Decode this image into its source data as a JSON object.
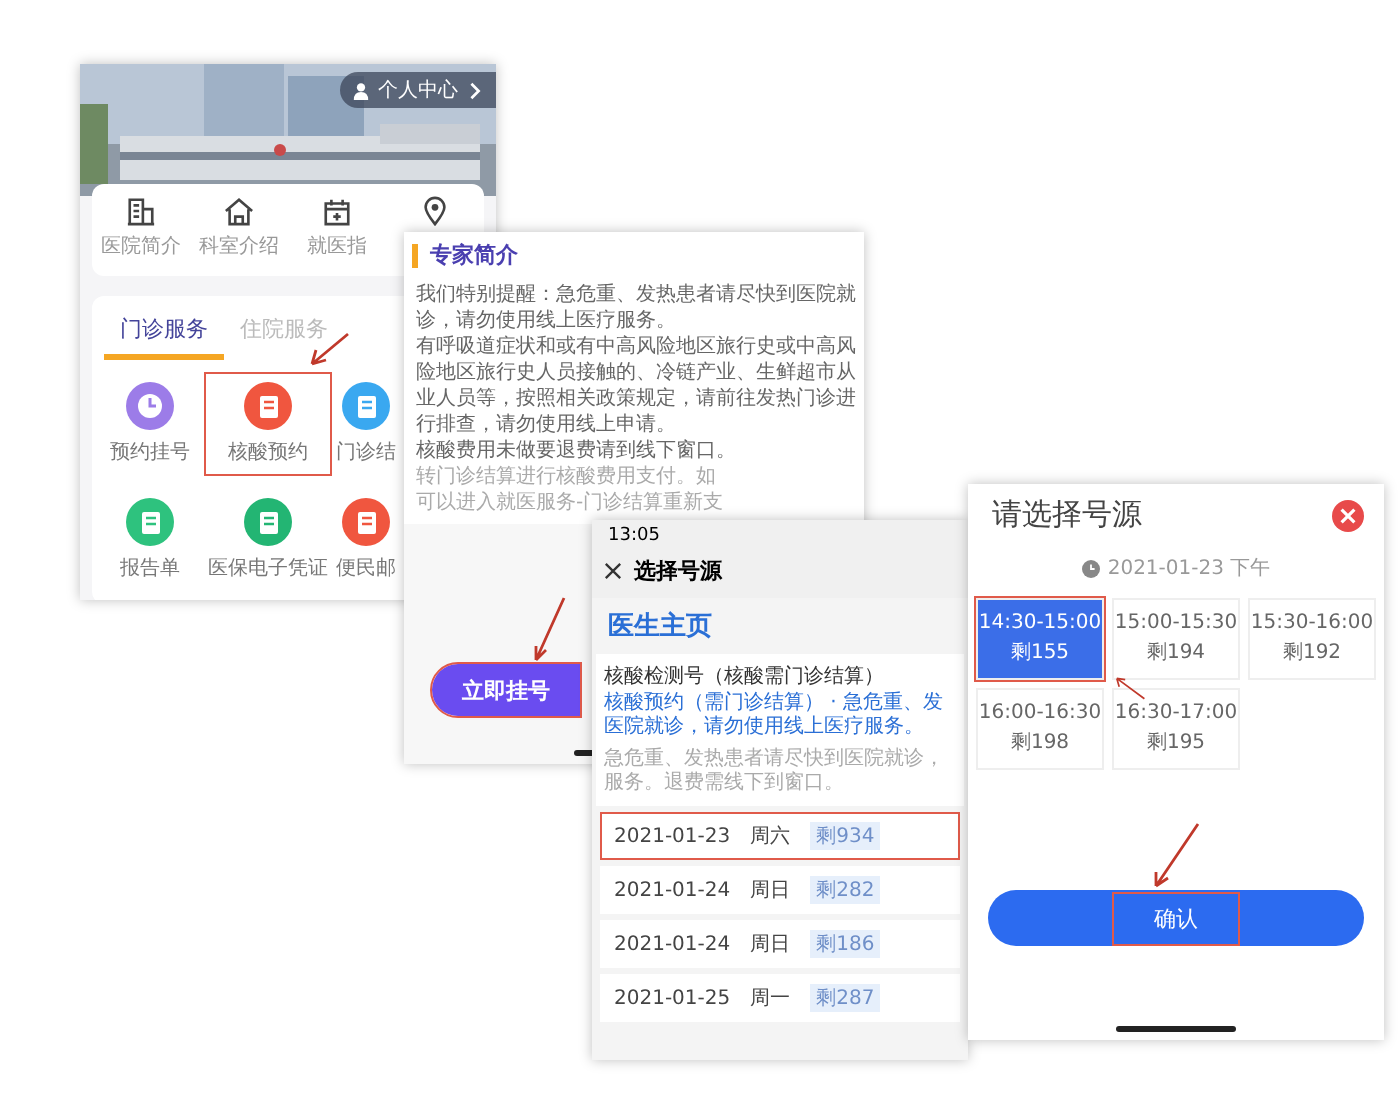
{
  "home_screen": {
    "profile_link": "个人中心",
    "quick_links": [
      "医院简介",
      "科室介绍",
      "就医指"
    ],
    "tabs": [
      {
        "label": "门诊服务",
        "selected": true
      },
      {
        "label": "住院服务",
        "selected": false
      }
    ],
    "services": [
      {
        "label": "预约挂号",
        "color": "#9c7ce8",
        "highlighted": false
      },
      {
        "label": "核酸预约",
        "color": "#f0563f",
        "highlighted": true
      },
      {
        "label": "门诊结",
        "color": "#3aa8f0",
        "highlighted": false
      },
      {
        "label": "报告单",
        "color": "#2ec27e",
        "highlighted": false
      },
      {
        "label": "医保电子凭证",
        "color": "#23b573",
        "highlighted": false
      },
      {
        "label": "便民邮",
        "color": "#f0563f",
        "highlighted": false
      }
    ]
  },
  "notice_screen": {
    "title": "专家简介",
    "lines": [
      {
        "text": "我们特别提醒：急危重、发热患者请尽快到医院就",
        "muted": false
      },
      {
        "text": "诊，请勿使用线上医疗服务。",
        "muted": false
      },
      {
        "text": "有呼吸道症状和或有中高风险地区旅行史或中高风",
        "muted": false
      },
      {
        "text": "险地区旅行史人员接触的、冷链产业、生鲜超市从",
        "muted": false
      },
      {
        "text": "业人员等，按照相关政策规定，请前往发热门诊进",
        "muted": false
      },
      {
        "text": "行排查，请勿使用线上申请。",
        "muted": false
      },
      {
        "text": "核酸费用未做要退费请到线下窗口。",
        "muted": false
      },
      {
        "text": "转门诊结算进行核酸费用支付。如",
        "muted": true
      },
      {
        "text": "可以进入就医服务-门诊结算重新支",
        "muted": true
      }
    ],
    "button": {
      "label": "立即挂号",
      "highlighted": true
    }
  },
  "schedule_screen": {
    "time": "13:05",
    "title": "选择号源",
    "doctor_link": "医生主页",
    "card": {
      "title": "核酸检测号（核酸需门诊结算）",
      "notice_lines": [
        "核酸预约（需门诊结算） · 急危重、发",
        "医院就诊，请勿使用线上医疗服务。"
      ],
      "note_lines": [
        "急危重、发热患者请尽快到医院就诊，",
        "服务。退费需线下到窗口。"
      ]
    },
    "dates": [
      {
        "date": "2021-01-23",
        "weekday": "周六",
        "remaining": "剩934",
        "highlighted": true
      },
      {
        "date": "2021-01-24",
        "weekday": "周日",
        "remaining": "剩282",
        "highlighted": false
      },
      {
        "date": "2021-01-24",
        "weekday": "周日",
        "remaining": "剩186",
        "highlighted": false
      },
      {
        "date": "2021-01-25",
        "weekday": "周一",
        "remaining": "剩287",
        "highlighted": false
      }
    ]
  },
  "slot_screen": {
    "title": "请选择号源",
    "session": "2021-01-23 下午",
    "slots": [
      {
        "time": "14:30-15:00",
        "remaining": "剩155",
        "selected": true,
        "highlighted": true
      },
      {
        "time": "15:00-15:30",
        "remaining": "剩194",
        "selected": false,
        "highlighted": false
      },
      {
        "time": "15:30-16:00",
        "remaining": "剩192",
        "selected": false,
        "highlighted": false
      },
      {
        "time": "16:00-16:30",
        "remaining": "剩198",
        "selected": false,
        "highlighted": false
      },
      {
        "time": "16:30-17:00",
        "remaining": "剩195",
        "selected": false,
        "highlighted": false
      }
    ],
    "confirm": {
      "label": "确认",
      "highlighted": true
    }
  }
}
